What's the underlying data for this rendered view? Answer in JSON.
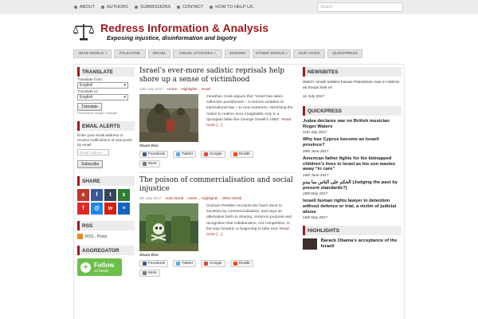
{
  "topnav": [
    "ABOUT",
    "AUTHORS",
    "SUBMISSIONS",
    "CONTACT",
    "HOW TO HELP US"
  ],
  "search": {
    "placeholder": "Search"
  },
  "site": {
    "title": "Redress Information & Analysis",
    "tagline": "Exposing injustice, disinformation and bigotry"
  },
  "mainnav": [
    {
      "label": "ARAB WORLD »"
    },
    {
      "label": "PALESTINE"
    },
    {
      "label": "ISRAEL"
    },
    {
      "label": "ISRAEL STOOGES »"
    },
    {
      "label": "ZIONISM"
    },
    {
      "label": "OTHER WORLD »"
    },
    {
      "label": "OUR VOICE"
    },
    {
      "label": "QUICKPRESS"
    }
  ],
  "translate": {
    "heading": "TRANSLATE",
    "from_label": "Translate from:",
    "from_value": "English",
    "to_label": "Translate to:",
    "to_value": "English",
    "button": "Translate",
    "powered": "Powered by Google Translate"
  },
  "email_alerts": {
    "heading": "EMAIL ALERTS",
    "text": "Enter your email address to receive notifications of new posts by email",
    "placeholder": "Email Address",
    "button": "Subscribe"
  },
  "share": {
    "heading": "SHARE",
    "icons": [
      {
        "name": "ask-icon",
        "glyph": "a",
        "color": "#c0392b"
      },
      {
        "name": "facebook-icon",
        "glyph": "f",
        "color": "#3b5998"
      },
      {
        "name": "tumblr-icon",
        "glyph": "t",
        "color": "#36465d"
      },
      {
        "name": "stumbleupon-icon",
        "glyph": "s",
        "color": "#2e7d32"
      },
      {
        "name": "flipboard-icon",
        "glyph": "f",
        "color": "#e12828"
      },
      {
        "name": "email-icon",
        "glyph": "@",
        "color": "#1e88e5"
      },
      {
        "name": "weibo-icon",
        "glyph": "w",
        "color": "#d81e06"
      },
      {
        "name": "more-share-icon",
        "glyph": "≡",
        "color": "#1565c0"
      }
    ]
  },
  "rss": {
    "heading": "RSS",
    "link": "RSS - Posts"
  },
  "aggregator": {
    "heading": "AGGREGATOR",
    "follow": "Follow",
    "on": "on feedly"
  },
  "posts": [
    {
      "title": "Israel’s ever-more sadistic reprisals help shore up a sense of victimhood",
      "date": "12th July 2017",
      "categories": [
        "Home",
        "Highlights",
        "Israel"
      ],
      "excerpt": "Jonathan Cook argues that “Israel has taken collective punishment – a serious violation of international law – to new extremes, stretching the notion to realms once imaginable only in a dystopian fable like George Orwell’s 1984”.",
      "more": "Read more […]",
      "share_label": "Share this:",
      "share_buttons": [
        "Facebook",
        "Twitter",
        "Google",
        "Reddit",
        "More"
      ]
    },
    {
      "title": "The poison of commercialisation and social injustice",
      "date": "8th July 2017",
      "categories": [
        "Arab World",
        "Home",
        "Highlights",
        "Other World"
      ],
      "excerpt": "Graham Peebles recounts the harm done to societies by commercialisation, and says an alternative built on sharing, common purpose and recognition that collaboration, not competition, is the way forward, is beginning to take root.",
      "more": "Read more […]",
      "share_label": "Share this:",
      "share_buttons": [
        "Facebook",
        "Twitter",
        "Google",
        "Reddit",
        "More"
      ]
    }
  ],
  "newsbites": {
    "heading": "NEWSBITES",
    "text": "Watch: Israeli settlers harass Palestinian man in Hebron as troops look on",
    "date": "11 July 2017"
  },
  "quickpress": {
    "heading": "QUICKPRESS",
    "items": [
      {
        "title": "Judea declares war on British musician Roger Waters",
        "date": "11th July 2017"
      },
      {
        "title": "Why has Cyprus become an Israeli province?",
        "date": "20th June 2017"
      },
      {
        "title": "American father fights for his kidnapped children’s lives in Israel as his son wastes away “in care”",
        "date": "19th June 2017"
      },
      {
        "title": "الحكم على الناس بما يبدو (Judging the past by present standards?)",
        "date": "26th May 2017"
      },
      {
        "title": "Israeli human rights lawyer in detention without defence or trial, a victim of judicial abuse",
        "date": "16th May 2017"
      }
    ]
  },
  "highlights": {
    "heading": "HIGHLIGHTS",
    "first": "Barack Obama’s acceptance of the Israeli"
  }
}
